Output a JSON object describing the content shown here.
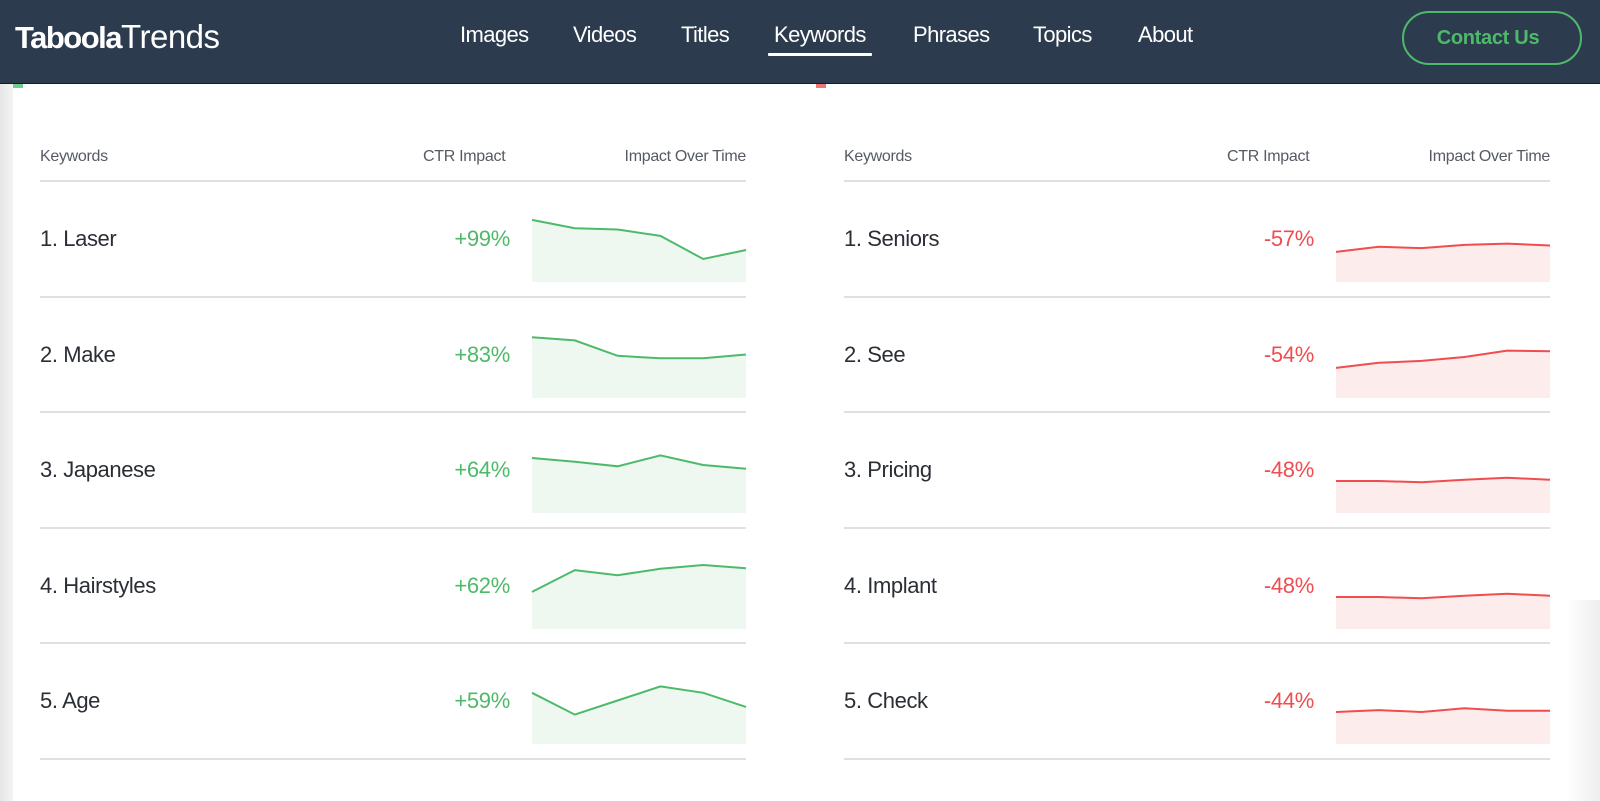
{
  "header": {
    "logo": {
      "bold": "Taboola",
      "light": "Trends"
    },
    "nav": [
      {
        "label": "Images",
        "active": false
      },
      {
        "label": "Videos",
        "active": false
      },
      {
        "label": "Titles",
        "active": false
      },
      {
        "label": "Keywords",
        "active": true
      },
      {
        "label": "Phrases",
        "active": false
      },
      {
        "label": "Topics",
        "active": false
      },
      {
        "label": "About",
        "active": false
      }
    ],
    "contact_label": "Contact Us"
  },
  "colors": {
    "header_bg": "#2d3b4f",
    "positive": "#4dba6a",
    "positive_fill": "#eef8f1",
    "negative": "#ef4d4f",
    "negative_fill": "#fdecec"
  },
  "positive_panel": {
    "columns": {
      "keyword": "Keywords",
      "ctr": "CTR Impact",
      "trend": "Impact Over Time"
    },
    "rows": [
      {
        "rank": "1.",
        "keyword": "Laser",
        "ctr": "+99%",
        "trend": [
          0.97,
          0.84,
          0.82,
          0.72,
          0.36,
          0.5
        ]
      },
      {
        "rank": "2.",
        "keyword": "Make",
        "ctr": "+83%",
        "trend": [
          0.95,
          0.9,
          0.66,
          0.62,
          0.62,
          0.68
        ]
      },
      {
        "rank": "3.",
        "keyword": "Japanese",
        "ctr": "+64%",
        "trend": [
          0.86,
          0.8,
          0.73,
          0.9,
          0.75,
          0.69
        ]
      },
      {
        "rank": "4.",
        "keyword": "Hairstyles",
        "ctr": "+62%",
        "trend": [
          0.58,
          0.92,
          0.84,
          0.94,
          1.0,
          0.95
        ]
      },
      {
        "rank": "5.",
        "keyword": "Age",
        "ctr": "+59%",
        "trend": [
          0.8,
          0.46,
          0.68,
          0.9,
          0.8,
          0.58
        ]
      }
    ]
  },
  "negative_panel": {
    "columns": {
      "keyword": "Keywords",
      "ctr": "CTR Impact",
      "trend": "Impact Over Time"
    },
    "rows": [
      {
        "rank": "1.",
        "keyword": "Seniors",
        "ctr": "-57%",
        "trend": [
          0.47,
          0.55,
          0.53,
          0.58,
          0.6,
          0.57
        ]
      },
      {
        "rank": "2.",
        "keyword": "See",
        "ctr": "-54%",
        "trend": [
          0.47,
          0.55,
          0.58,
          0.64,
          0.74,
          0.73
        ]
      },
      {
        "rank": "3.",
        "keyword": "Pricing",
        "ctr": "-48%",
        "trend": [
          0.5,
          0.5,
          0.48,
          0.52,
          0.55,
          0.52
        ]
      },
      {
        "rank": "4.",
        "keyword": "Implant",
        "ctr": "-48%",
        "trend": [
          0.5,
          0.5,
          0.48,
          0.52,
          0.55,
          0.52
        ]
      },
      {
        "rank": "5.",
        "keyword": "Check",
        "ctr": "-44%",
        "trend": [
          0.5,
          0.53,
          0.5,
          0.56,
          0.52,
          0.52
        ]
      }
    ]
  }
}
